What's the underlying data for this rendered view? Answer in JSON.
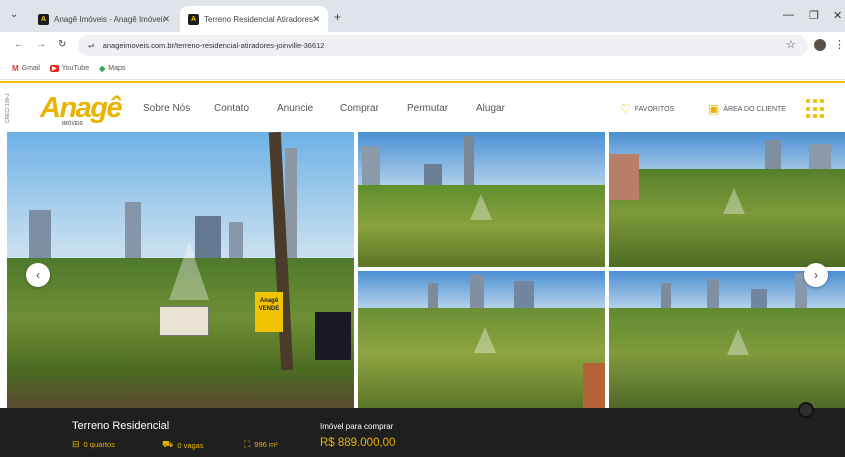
{
  "browser": {
    "tabs": [
      {
        "title": "Anagê Imóveis - Anagê Imóveis",
        "favicon": "A",
        "active": false
      },
      {
        "title": "Terreno Residencial Atiradores",
        "favicon": "A",
        "active": true
      }
    ],
    "url": "anageimoveis.com.br/terreno-residencial-atiradores-joinville-36612",
    "bookmarks": [
      {
        "label": "Gmail",
        "icon": "gmail-icon"
      },
      {
        "label": "YouTube",
        "icon": "youtube-icon"
      },
      {
        "label": "Maps",
        "icon": "maps-icon"
      }
    ]
  },
  "site": {
    "side_tab": "CRECI 100-J",
    "logo": {
      "text": "Anagê",
      "sub": "IMÓVEIS"
    },
    "menu": [
      "Sobre Nós",
      "Contato",
      "Anuncie",
      "Comprar",
      "Permutar",
      "Alugar"
    ],
    "favorites_label": "FAVORITOS",
    "client_area_label": "ÁREA DO CLIENTE"
  },
  "listing": {
    "title": "Terreno Residencial",
    "bedrooms": "0 quartos",
    "parking": "0 vagas",
    "area": "996 m²",
    "price_label": "Imóvel para comprar",
    "price": "R$ 889.000,00",
    "sign_text": "Anagê VENDE"
  },
  "colors": {
    "brand": "#f2c400",
    "footer_bg": "#1f1f1f",
    "accent_text": "#e8b400"
  }
}
